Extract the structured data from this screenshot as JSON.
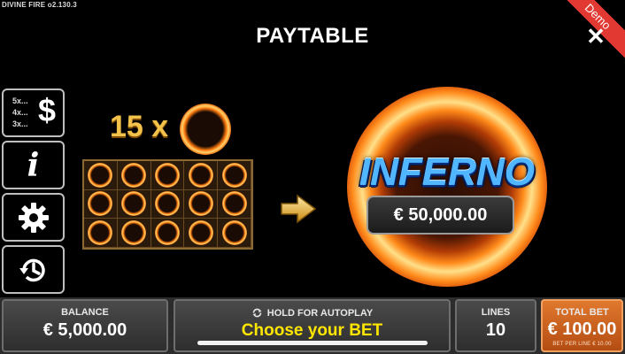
{
  "header": {
    "version": "DIVINE FIRE  o2.130.3",
    "title": "PAYTABLE",
    "demo_label": "Demo",
    "close_glyph": "✕"
  },
  "sidebar": {
    "paytable": {
      "lines": [
        "5x...",
        "4x...",
        "3x..."
      ],
      "symbol": "$",
      "icon": "paytable-icon"
    },
    "info": {
      "symbol": "i",
      "icon": "info-icon"
    },
    "settings": {
      "icon": "gear-icon"
    },
    "history": {
      "icon": "history-icon"
    }
  },
  "paytable": {
    "count_label": "15 x",
    "grid": {
      "rows": 3,
      "cols": 5
    },
    "prize_name": "INFERNO",
    "prize_value": "€ 50,000.00"
  },
  "bottom_bar": {
    "balance": {
      "label": "BALANCE",
      "value": "€ 5,000.00"
    },
    "autoplay": {
      "label": "HOLD FOR AUTOPLAY",
      "cta": "Choose your BET"
    },
    "lines": {
      "label": "LINES",
      "value": "10"
    },
    "total_bet": {
      "label": "TOTAL BET",
      "value": "€ 100.00",
      "sub": "BET PER LINE € 10.00"
    }
  },
  "colors": {
    "demo_ribbon": "#e23a33",
    "total_bet_bg": "#c85f1e",
    "cta_yellow": "#ffe600",
    "inferno_blue": "#4fb6ff",
    "count_gold": "#f3c24a"
  }
}
